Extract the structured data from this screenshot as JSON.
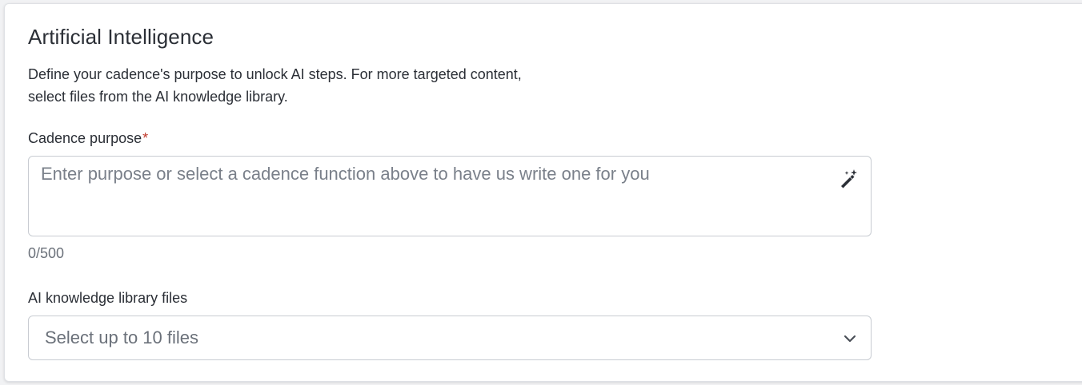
{
  "section": {
    "title": "Artificial Intelligence",
    "description_line1": "Define your cadence's purpose to unlock AI steps. For more targeted content,",
    "description_line2": "select files from the AI knowledge library."
  },
  "purpose_field": {
    "label": "Cadence purpose",
    "required_marker": "*",
    "placeholder": "Enter purpose or select a cadence function above to have us write one for you",
    "value": "",
    "char_count": "0/500",
    "ai_icon": "magic-wand-icon"
  },
  "files_field": {
    "label": "AI knowledge library files",
    "placeholder": "Select up to 10 files",
    "dropdown_icon": "chevron-down-icon"
  },
  "colors": {
    "required": "#c0392b",
    "border": "#c8ccd2",
    "placeholder": "#7a808a"
  }
}
